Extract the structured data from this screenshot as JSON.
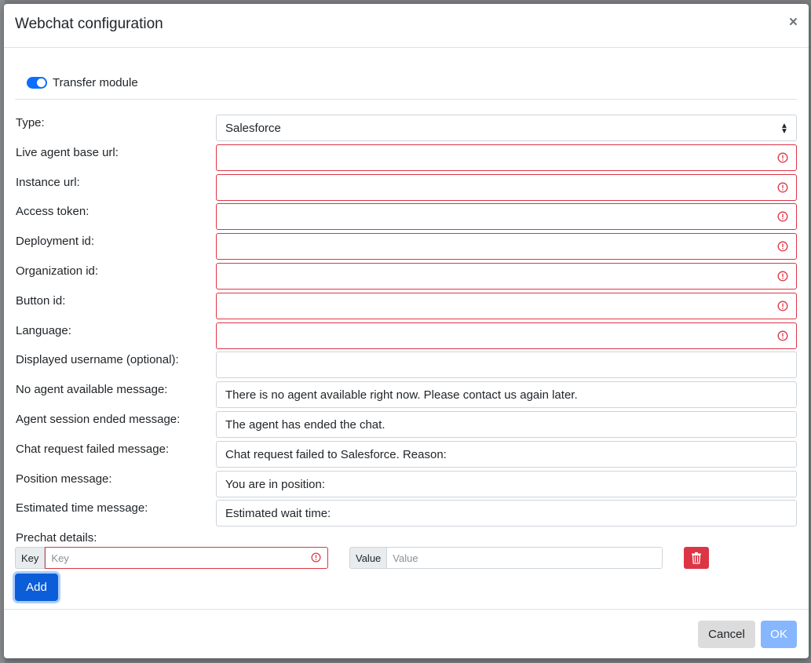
{
  "modal": {
    "title": "Webchat configuration",
    "close_label": "×"
  },
  "transfer_module": {
    "label": "Transfer module",
    "enabled": true
  },
  "form": {
    "type": {
      "label": "Type:",
      "value": "Salesforce"
    },
    "live_agent_base_url": {
      "label": "Live agent base url:",
      "value": ""
    },
    "instance_url": {
      "label": "Instance url:",
      "value": ""
    },
    "access_token": {
      "label": "Access token:",
      "value": ""
    },
    "deployment_id": {
      "label": "Deployment id:",
      "value": ""
    },
    "organization_id": {
      "label": "Organization id:",
      "value": ""
    },
    "button_id": {
      "label": "Button id:",
      "value": ""
    },
    "language": {
      "label": "Language:",
      "value": ""
    },
    "displayed_username": {
      "label": "Displayed username (optional):",
      "value": ""
    },
    "no_agent_message": {
      "label": "No agent available message:",
      "value": "There is no agent available right now. Please contact us again later."
    },
    "session_ended_message": {
      "label": "Agent session ended message:",
      "value": "The agent has ended the chat."
    },
    "chat_failed_message": {
      "label": "Chat request failed message:",
      "value": "Chat request failed to Salesforce. Reason:"
    },
    "position_message": {
      "label": "Position message:",
      "value": "You are in position:"
    },
    "estimated_time_message": {
      "label": "Estimated time message:",
      "value": "Estimated wait time:"
    }
  },
  "prechat": {
    "label": "Prechat details:",
    "key_addon": "Key",
    "key_placeholder": "Key",
    "value_addon": "Value",
    "value_placeholder": "Value",
    "add_label": "Add"
  },
  "footer": {
    "cancel_label": "Cancel",
    "ok_label": "OK"
  },
  "colors": {
    "primary": "#0d6efd",
    "danger": "#dc3545",
    "ok_disabled": "#86b7fe"
  }
}
